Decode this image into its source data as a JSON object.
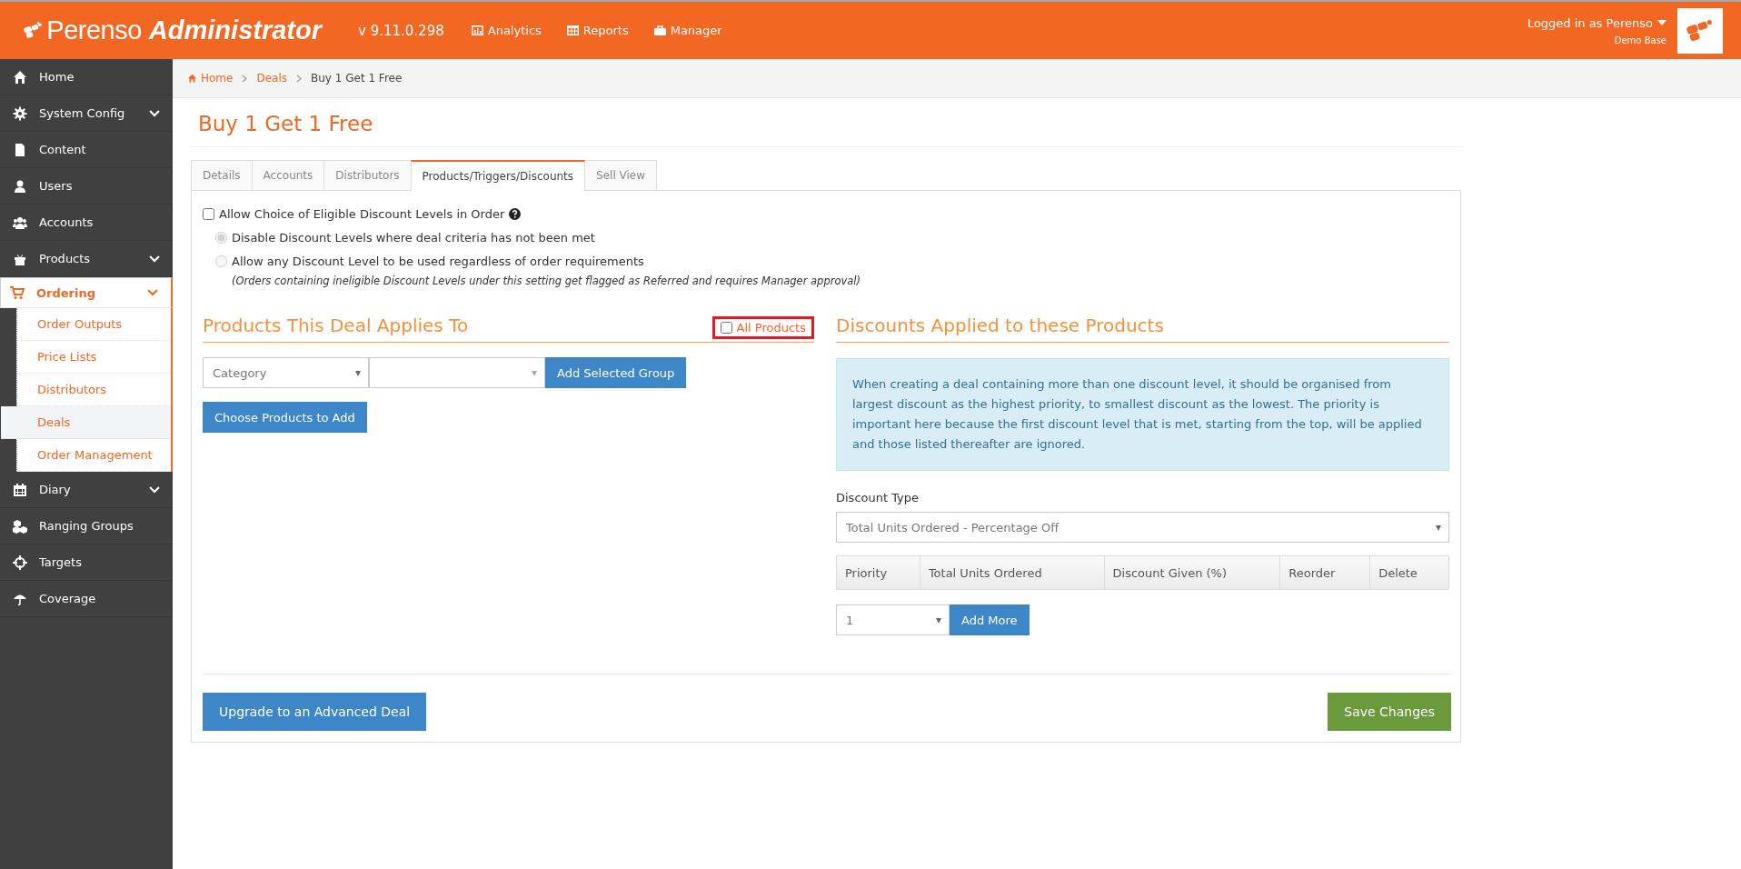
{
  "header": {
    "brand": {
      "name": "Perenso",
      "product": "Administrator"
    },
    "version": "v 9.11.0.298",
    "nav": [
      {
        "label": "Analytics"
      },
      {
        "label": "Reports"
      },
      {
        "label": "Manager"
      }
    ],
    "user": {
      "logged_in": "Logged in as Perenso",
      "base": "Demo Base"
    }
  },
  "sidebar": {
    "items": [
      {
        "label": "Home",
        "expandable": false,
        "expanded": false,
        "selected": false
      },
      {
        "label": "System Config",
        "expandable": true,
        "expanded": false,
        "selected": false
      },
      {
        "label": "Content",
        "expandable": false,
        "expanded": false,
        "selected": false
      },
      {
        "label": "Users",
        "expandable": false,
        "expanded": false,
        "selected": false
      },
      {
        "label": "Accounts",
        "expandable": false,
        "expanded": false,
        "selected": false
      },
      {
        "label": "Products",
        "expandable": true,
        "expanded": false,
        "selected": false
      },
      {
        "label": "Ordering",
        "expandable": true,
        "expanded": true,
        "selected": true,
        "children": [
          {
            "label": "Order Outputs",
            "selected": false
          },
          {
            "label": "Price Lists",
            "selected": false
          },
          {
            "label": "Distributors",
            "selected": false
          },
          {
            "label": "Deals",
            "selected": true
          },
          {
            "label": "Order Management",
            "selected": false
          }
        ]
      },
      {
        "label": "Diary",
        "expandable": true,
        "expanded": false,
        "selected": false
      },
      {
        "label": "Ranging Groups",
        "expandable": false,
        "expanded": false,
        "selected": false
      },
      {
        "label": "Targets",
        "expandable": false,
        "expanded": false,
        "selected": false
      },
      {
        "label": "Coverage",
        "expandable": false,
        "expanded": false,
        "selected": false
      }
    ]
  },
  "breadcrumb": [
    {
      "label": "Home"
    },
    {
      "label": "Deals"
    },
    {
      "label": "Buy 1 Get 1 Free"
    }
  ],
  "page_title": "Buy 1 Get 1 Free",
  "tabs": [
    {
      "label": "Details",
      "selected": false
    },
    {
      "label": "Accounts",
      "selected": false
    },
    {
      "label": "Distributors",
      "selected": false
    },
    {
      "label": "Products/Triggers/Discounts",
      "selected": true
    },
    {
      "label": "Sell View",
      "selected": false
    }
  ],
  "allow_choice": {
    "label": "Allow Choice of Eligible Discount Levels in Order",
    "checked": false
  },
  "discount_options": [
    {
      "label": "Disable Discount Levels where deal criteria has not been met",
      "selected": true
    },
    {
      "label": "Allow any Discount Level to be used regardless of order requirements",
      "selected": false
    }
  ],
  "option_note": "(Orders containing ineligible Discount Levels under this setting get flagged as Referred and requires Manager approval)",
  "products": {
    "heading": "Products This Deal Applies To",
    "all_products": {
      "label": "All Products",
      "checked": false,
      "highlighted": true
    },
    "group_type": "Category",
    "add_group_button": "Add Selected Group",
    "choose_button": "Choose Products to Add"
  },
  "discounts": {
    "heading": "Discounts Applied to these Products",
    "info": "When creating a deal containing more than one discount level, it should be organised from largest discount as the highest priority, to smallest discount as the lowest. The priority is important here because the first discount level that is met, starting from the top, will be applied and those listed thereafter are ignored.",
    "type_label": "Discount Type",
    "type_value": "Total Units Ordered - Percentage Off",
    "table": {
      "columns": [
        "Priority",
        "Total Units Ordered",
        "Discount Given (%)",
        "Reorder",
        "Delete"
      ]
    },
    "count_value": "1",
    "add_more_button": "Add More"
  },
  "footer_buttons": {
    "upgrade": "Upgrade to an Advanced Deal",
    "save": "Save Changes"
  }
}
